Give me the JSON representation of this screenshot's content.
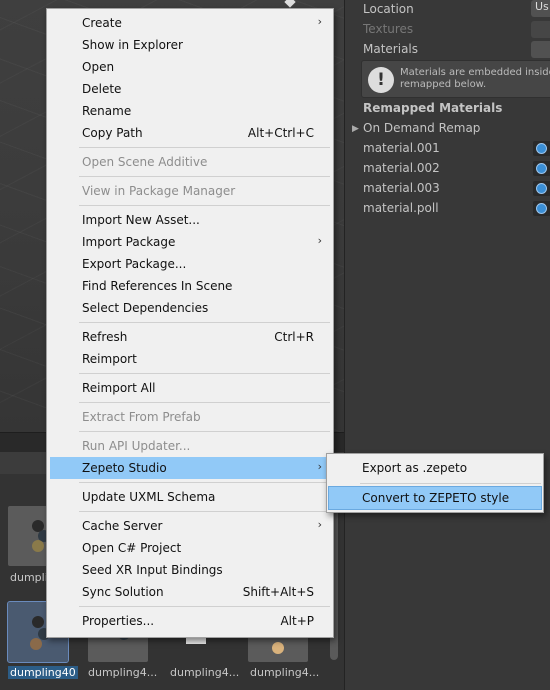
{
  "inspector": {
    "location_label": "Location",
    "location_value": "Us",
    "textures_label": "Textures",
    "materials_label": "Materials",
    "warning_text": "Materials are embedded inside t remapped below.",
    "remapped_header": "Remapped Materials",
    "on_demand_remap": "On Demand Remap",
    "materials": [
      "material.001",
      "material.002",
      "material.003",
      "material.poll"
    ]
  },
  "project": {
    "items": [
      "dumpling",
      "dumpling40",
      "dumpling4...",
      "dumpling4...",
      "dumpling4..."
    ]
  },
  "context_menu": {
    "items": [
      {
        "label": "Create",
        "submenu": true
      },
      {
        "label": "Show in Explorer"
      },
      {
        "label": "Open"
      },
      {
        "label": "Delete"
      },
      {
        "label": "Rename"
      },
      {
        "label": "Copy Path",
        "shortcut": "Alt+Ctrl+C"
      },
      {
        "label": "Open Scene Additive",
        "disabled": true
      },
      {
        "label": "View in Package Manager",
        "disabled": true
      },
      {
        "label": "Import New Asset..."
      },
      {
        "label": "Import Package",
        "submenu": true
      },
      {
        "label": "Export Package..."
      },
      {
        "label": "Find References In Scene"
      },
      {
        "label": "Select Dependencies"
      },
      {
        "label": "Refresh",
        "shortcut": "Ctrl+R"
      },
      {
        "label": "Reimport"
      },
      {
        "label": "Reimport All"
      },
      {
        "label": "Extract From Prefab",
        "disabled": true
      },
      {
        "label": "Run API Updater...",
        "disabled": true
      },
      {
        "label": "Zepeto Studio",
        "submenu": true,
        "highlighted": true
      },
      {
        "label": "Update UXML Schema"
      },
      {
        "label": "Cache Server",
        "submenu": true
      },
      {
        "label": "Open C# Project"
      },
      {
        "label": "Seed XR Input Bindings"
      },
      {
        "label": "Sync Solution",
        "shortcut": "Shift+Alt+S"
      },
      {
        "label": "Properties...",
        "shortcut": "Alt+P"
      }
    ]
  },
  "submenu": {
    "items": [
      {
        "label": "Export as .zepeto"
      },
      {
        "label": "Convert to ZEPETO style",
        "highlighted": true
      }
    ]
  },
  "icons": {
    "submenu_arrow": "chevron-right-icon",
    "warning": "warning-icon",
    "foldout": "triangle-right-icon",
    "material_object": "object-picker-icon"
  }
}
